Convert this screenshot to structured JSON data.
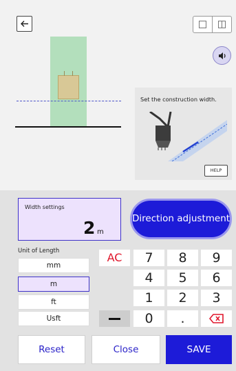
{
  "hint": {
    "text": "Set the construction width.",
    "help_label": "HELP"
  },
  "width": {
    "label": "Width settings",
    "value": "2",
    "unit": "m"
  },
  "direction_button_label": "Direction adjustment",
  "units": {
    "label": "Unit of Length",
    "options": [
      "mm",
      "m",
      "ft",
      "Usft"
    ],
    "selected": "m"
  },
  "keypad": {
    "ac": "AC",
    "row1": [
      "7",
      "8",
      "9"
    ],
    "row2": [
      "4",
      "5",
      "6"
    ],
    "row3": [
      "1",
      "2",
      "3"
    ],
    "zero": "0",
    "dot": "."
  },
  "buttons": {
    "reset": "Reset",
    "close": "Close",
    "save": "SAVE"
  },
  "colors": {
    "accent": "#1d1bd8",
    "selected_fill": "#ede2fd",
    "ac_red": "#e0162b",
    "zone_green": "#b3dfbc"
  },
  "icons": [
    "back-arrow-icon",
    "single-view-icon",
    "split-view-icon",
    "speaker-icon",
    "backspace-icon",
    "excavator-illustration"
  ]
}
